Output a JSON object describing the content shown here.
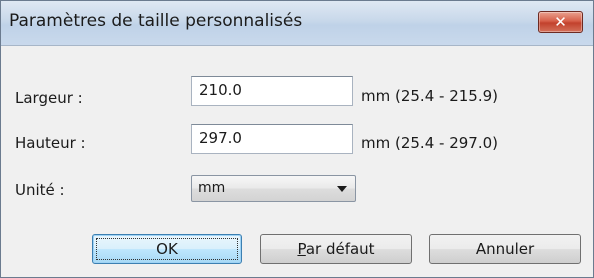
{
  "dialog": {
    "title": "Paramètres de taille personnalisés",
    "close_glyph": "✕"
  },
  "fields": [
    {
      "label": "Largeur :",
      "value": "210.0",
      "range": "mm (25.4 - 215.9)"
    },
    {
      "label": "Hauteur :",
      "value": "297.0",
      "range": "mm (25.4 - 297.0)"
    }
  ],
  "unit": {
    "label": "Unité :",
    "selected": "mm"
  },
  "buttons": {
    "ok": "OK",
    "default_mnemonic": "P",
    "default_rest": "ar défaut",
    "cancel": "Annuler"
  }
}
